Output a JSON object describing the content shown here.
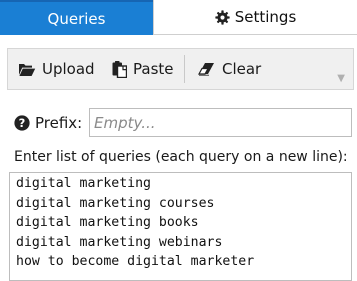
{
  "tabs": {
    "queries_label": "Queries",
    "settings_label": "Settings",
    "active_color": "#1a7fd4"
  },
  "toolbar": {
    "upload_label": "Upload",
    "paste_label": "Paste",
    "clear_label": "Clear",
    "upload_icon": "folder-open-icon",
    "paste_icon": "paste-icon",
    "clear_icon": "eraser-icon"
  },
  "prefix": {
    "label": "Prefix:",
    "placeholder": "Empty...",
    "value": "",
    "icon": "question-circle-icon"
  },
  "queries": {
    "label": "Enter list of queries (each query on a new line):",
    "text": "digital marketing\ndigital marketing courses\ndigital marketing books\ndigital marketing webinars\nhow to become digital marketer"
  }
}
